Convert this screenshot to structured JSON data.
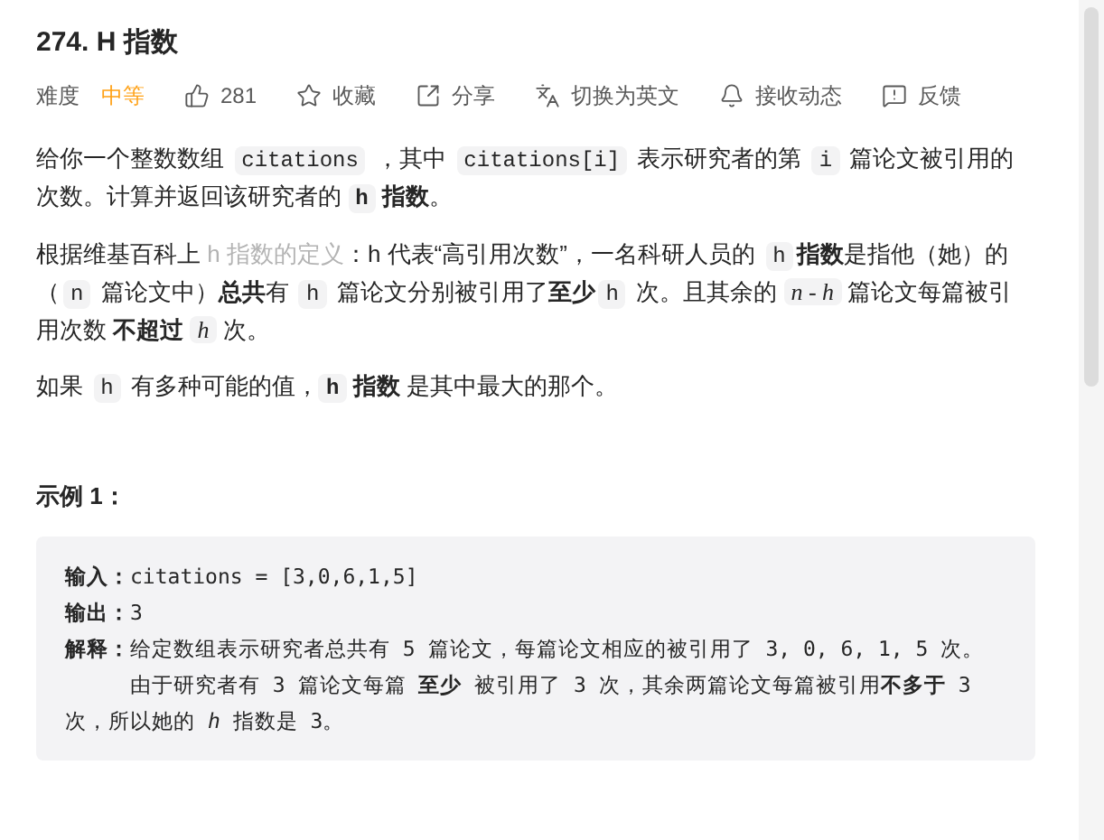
{
  "title": "274. H 指数",
  "difficulty": {
    "label": "难度",
    "value": "中等"
  },
  "actions": [
    {
      "kind": "like",
      "label": "281"
    },
    {
      "kind": "star",
      "label": "收藏"
    },
    {
      "kind": "share",
      "label": "分享"
    },
    {
      "kind": "translate",
      "label": "切换为英文"
    },
    {
      "kind": "bell",
      "label": "接收动态"
    },
    {
      "kind": "feedback",
      "label": "反馈"
    }
  ],
  "paragraphs": [
    [
      {
        "kind": "text",
        "text": "给你一个整数数组 "
      },
      {
        "kind": "code",
        "text": "citations"
      },
      {
        "kind": "text",
        "text": " ，其中 "
      },
      {
        "kind": "code",
        "text": "citations[i]"
      },
      {
        "kind": "text",
        "text": " 表示研究者的第 "
      },
      {
        "kind": "code",
        "text": "i"
      },
      {
        "kind": "text",
        "text": " 篇论文被引用的次数。计算并返回该研究者的 "
      },
      {
        "kind": "code_bold",
        "text": "h"
      },
      {
        "kind": "bold",
        "text": " 指数"
      },
      {
        "kind": "text",
        "text": "。"
      }
    ],
    [
      {
        "kind": "text",
        "text": "根据维基百科上 "
      },
      {
        "kind": "link",
        "text": "h 指数的定义"
      },
      {
        "kind": "text",
        "text": "：h 代表“高引用次数”，一名科研人员的 "
      },
      {
        "kind": "code",
        "text": "h"
      },
      {
        "kind": "bold",
        "text": "指数"
      },
      {
        "kind": "text",
        "text": "是指他（她）的（"
      },
      {
        "kind": "code",
        "text": "n"
      },
      {
        "kind": "text",
        "text": " 篇论文中）"
      },
      {
        "kind": "bold",
        "text": "总共"
      },
      {
        "kind": "text",
        "text": "有 "
      },
      {
        "kind": "code",
        "text": "h"
      },
      {
        "kind": "text",
        "text": " 篇论文分别被引用了"
      },
      {
        "kind": "bold",
        "text": "至少"
      },
      {
        "kind": "code",
        "text": "h"
      },
      {
        "kind": "text",
        "text": " 次。且其余的 "
      },
      {
        "kind": "math",
        "text": "n - h"
      },
      {
        "kind": "text",
        "text": " 篇论文每篇被引用次数 "
      },
      {
        "kind": "bold",
        "text": "不超过 "
      },
      {
        "kind": "math",
        "text": "h"
      },
      {
        "kind": "text",
        "text": " 次。"
      }
    ],
    [
      {
        "kind": "text",
        "text": "如果 "
      },
      {
        "kind": "code",
        "text": "h"
      },
      {
        "kind": "text",
        "text": " 有多种可能的值，"
      },
      {
        "kind": "code_bold",
        "text": "h"
      },
      {
        "kind": "bold",
        "text": " 指数"
      },
      {
        "kind": "text",
        "text": " 是其中最大的那个。"
      }
    ]
  ],
  "example": {
    "title": "示例 1：",
    "lines": [
      {
        "indented": false,
        "parts": [
          {
            "kind": "bold",
            "text": "输入："
          },
          {
            "kind": "text",
            "text": "citations = [3,0,6,1,5]"
          }
        ]
      },
      {
        "indented": false,
        "parts": [
          {
            "kind": "bold",
            "text": "输出："
          },
          {
            "kind": "text",
            "text": "3"
          }
        ]
      },
      {
        "indented": false,
        "parts": [
          {
            "kind": "bold",
            "text": "解释："
          },
          {
            "kind": "text",
            "text": "给定数组表示研究者总共有 5 篇论文，每篇论文相应的被引用了 3, 0, 6, 1, 5 次。"
          }
        ]
      },
      {
        "indented": true,
        "parts": [
          {
            "kind": "text",
            "text": "由于研究者有 3 篇论文每篇 "
          },
          {
            "kind": "bold",
            "text": "至少"
          },
          {
            "kind": "text",
            "text": " 被引用了 3 次，其余两篇论文每篇被引用"
          },
          {
            "kind": "bold",
            "text": "不多于"
          },
          {
            "kind": "text",
            "text": " 3 次，所以她的 "
          },
          {
            "kind": "math",
            "text": "h"
          },
          {
            "kind": "text",
            "text": " 指数是 3。"
          }
        ]
      }
    ]
  }
}
